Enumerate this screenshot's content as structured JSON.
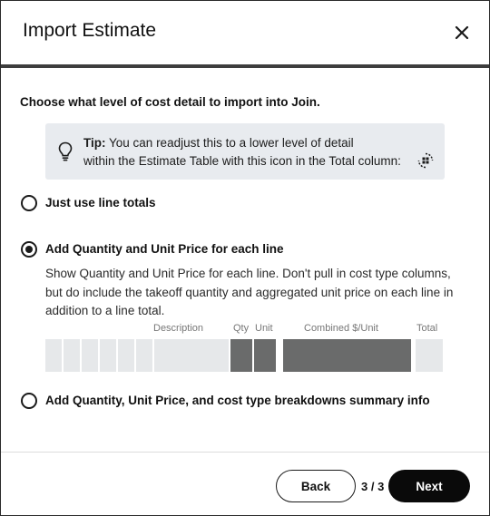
{
  "header": {
    "title": "Import Estimate",
    "close_icon": "close-icon"
  },
  "prompt": "Choose what level of cost detail to import into Join.",
  "tip": {
    "bold": "Tip:",
    "line1": "You can readjust this to a lower level of detail",
    "line2": "within the Estimate Table with this icon in the Total column:",
    "bulb_icon": "lightbulb-icon",
    "detail_icon": "detail-level-icon"
  },
  "options": [
    {
      "label": "Just use line totals",
      "checked": false
    },
    {
      "label": "Add Quantity and Unit Price for each line",
      "checked": true,
      "description": "Show Quantity and Unit Price for each line. Don't pull in cost type columns, but do include the takeoff quantity and aggregated unit price on each line in addition to a line total."
    },
    {
      "label": "Add Quantity, Unit Price, and cost type breakdowns summary info",
      "checked": false
    }
  ],
  "preview": {
    "columns": {
      "description": "Description",
      "qty": "Qty",
      "unit": "Unit",
      "combined": "Combined $/Unit",
      "total": "Total"
    }
  },
  "footer": {
    "back": "Back",
    "step": "3 / 3",
    "next": "Next"
  },
  "colors": {
    "primary_button": "#0a0a0a",
    "tip_background": "#e8ebef",
    "preview_light": "#e6e8ea",
    "preview_dark": "#6a6b6b"
  }
}
